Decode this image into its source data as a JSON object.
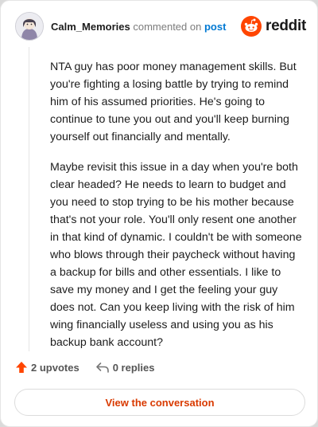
{
  "header": {
    "username": "Calm_Memories",
    "commented_on": "commented on",
    "post_link": "post",
    "brand": "reddit",
    "brand_color": "#ff4500"
  },
  "comment": {
    "paragraphs": [
      "NTA guy has poor money management skills. But you're fighting a losing battle by trying to remind him of his assumed priorities. He's going to continue to tune you out and you'll keep burning yourself out financially and mentally.",
      "Maybe revisit this issue in a day when you're both clear headed? He needs to learn to budget and you need to stop trying to be his mother because that's not your role. You'll only resent one another in that kind of dynamic. I couldn't be with someone who blows through their paycheck without having a backup for bills and other essentials. I like to save my money and I get the feeling your guy does not. Can you keep living with the risk of him wing financially useless and using you as his backup bank account?"
    ]
  },
  "actions": {
    "upvotes": "2 upvotes",
    "replies": "0 replies",
    "upvote_icon": "upvote-arrow-icon",
    "reply_icon": "reply-arrow-icon",
    "upvote_color": "#ff4500"
  },
  "cta": {
    "label": "View the conversation",
    "color": "#d93a00"
  }
}
